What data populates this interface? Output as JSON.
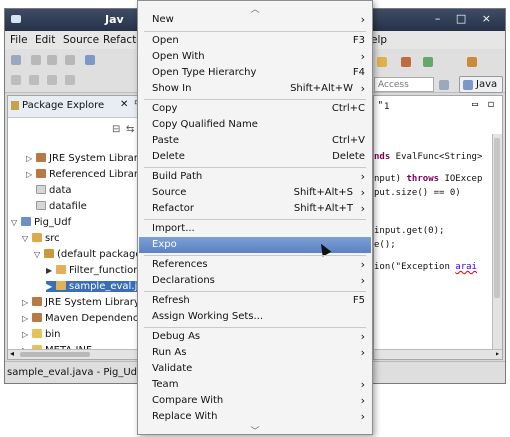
{
  "window": {
    "title": "Jav",
    "controls": "– □ ×"
  },
  "menubar": {
    "items": [
      "File",
      "Edit",
      "Source",
      "Refactc"
    ],
    "right_item": "elp"
  },
  "toolbar": {
    "access_placeholder": "Access",
    "perspective_label": "Java"
  },
  "package_explorer": {
    "title": "Package Explore",
    "tree": [
      {
        "label": "JRE System Library",
        "icon": "library-icon"
      },
      {
        "label": "Referenced Librarie",
        "icon": "library-icon"
      },
      {
        "label": "data",
        "icon": "file-icon"
      },
      {
        "label": "datafile",
        "icon": "file-icon"
      },
      {
        "label": "Pig_Udf",
        "icon": "project-icon"
      },
      {
        "label": "src",
        "icon": "source-folder-icon"
      },
      {
        "label": "(default package",
        "icon": "package-icon"
      },
      {
        "label": "Filter_function",
        "icon": "java-file-icon"
      },
      {
        "label": "sample_eval.ja",
        "icon": "java-file-icon"
      },
      {
        "label": "JRE System Library",
        "icon": "library-icon"
      },
      {
        "label": "Maven Dependenci",
        "icon": "library-icon"
      },
      {
        "label": "bin",
        "icon": "folder-icon"
      },
      {
        "label": "META-INF",
        "icon": "folder-icon"
      }
    ]
  },
  "editor": {
    "tab_number": "1",
    "lines": [
      {
        "kw": "nds",
        "text": " EvalFunc<String>"
      },
      {
        "kw": "",
        "text": "nput) "
      },
      {
        "kw": "throws",
        "text": " IOExcep"
      },
      {
        "kw": "",
        "text": "put.size() == 0)"
      },
      {
        "kw": "",
        "text": "input.get(0);"
      },
      {
        "kw": "",
        "text": "e();"
      },
      {
        "kw": "",
        "text": "ion(\"Exception "
      },
      {
        "kw": "",
        "text": "arai"
      }
    ]
  },
  "statusbar": {
    "text": "sample_eval.java - Pig_Udf/"
  },
  "context_menu": {
    "items": [
      {
        "label": "New",
        "shortcut": "",
        "submenu": true
      },
      {
        "label": "Open",
        "shortcut": "F3",
        "submenu": false
      },
      {
        "label": "Open With",
        "shortcut": "",
        "submenu": true
      },
      {
        "label": "Open Type Hierarchy",
        "shortcut": "F4",
        "submenu": false
      },
      {
        "label": "Show In",
        "shortcut": "Shift+Alt+W",
        "submenu": true
      },
      {
        "label": "Copy",
        "shortcut": "Ctrl+C",
        "submenu": false
      },
      {
        "label": "Copy Qualified Name",
        "shortcut": "",
        "submenu": false
      },
      {
        "label": "Paste",
        "shortcut": "Ctrl+V",
        "submenu": false
      },
      {
        "label": "Delete",
        "shortcut": "Delete",
        "submenu": false
      },
      {
        "label": "Build Path",
        "shortcut": "",
        "submenu": true
      },
      {
        "label": "Source",
        "shortcut": "Shift+Alt+S",
        "submenu": true
      },
      {
        "label": "Refactor",
        "shortcut": "Shift+Alt+T",
        "submenu": true
      },
      {
        "label": "Import...",
        "shortcut": "",
        "submenu": false
      },
      {
        "label": "Expo",
        "shortcut": "",
        "submenu": false
      },
      {
        "label": "References",
        "shortcut": "",
        "submenu": true
      },
      {
        "label": "Declarations",
        "shortcut": "",
        "submenu": true
      },
      {
        "label": "Refresh",
        "shortcut": "F5",
        "submenu": false
      },
      {
        "label": "Assign Working Sets...",
        "shortcut": "",
        "submenu": false
      },
      {
        "label": "Debug As",
        "shortcut": "",
        "submenu": true
      },
      {
        "label": "Run As",
        "shortcut": "",
        "submenu": true
      },
      {
        "label": "Validate",
        "shortcut": "",
        "submenu": false
      },
      {
        "label": "Team",
        "shortcut": "",
        "submenu": true
      },
      {
        "label": "Compare With",
        "shortcut": "",
        "submenu": true
      },
      {
        "label": "Replace With",
        "shortcut": "",
        "submenu": true
      }
    ],
    "highlighted": "Expo",
    "arrow_glyph": "›"
  },
  "colors": {
    "highlight": "#5a83c4",
    "title_bar": "#26324a",
    "selection": "#3a6fb5"
  }
}
